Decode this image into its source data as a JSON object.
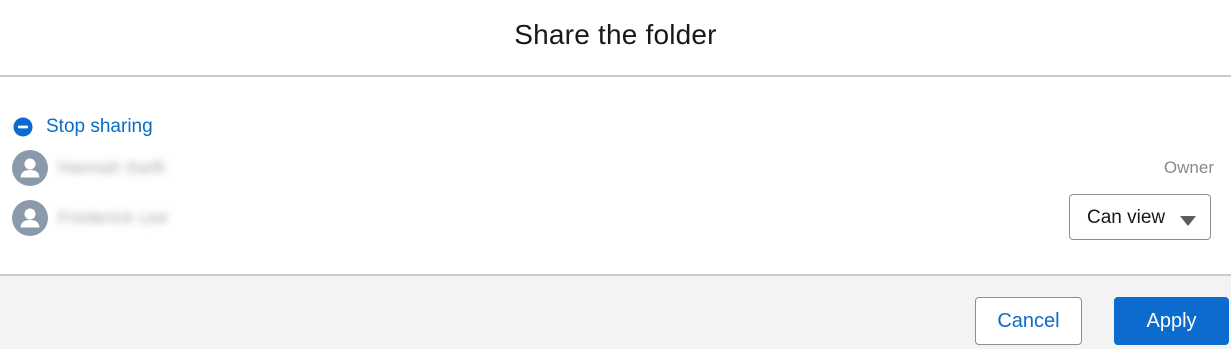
{
  "header": {
    "title": "Share the folder"
  },
  "actions": {
    "stop_sharing_label": "Stop sharing"
  },
  "users": [
    {
      "name": "Hannah Swift",
      "role": "Owner"
    },
    {
      "name": "Frederick Lee",
      "permission": "Can view"
    }
  ],
  "footer": {
    "cancel_label": "Cancel",
    "apply_label": "Apply"
  },
  "colors": {
    "accent": "#0b6bcf",
    "link": "#0b6bc8",
    "avatar": "#8b9aab",
    "footer_bg": "#f3f3f3"
  },
  "icons": {
    "stop_sharing": "minus-circle-icon",
    "user_avatar": "user-avatar-icon",
    "dropdown": "caret-down-icon"
  }
}
